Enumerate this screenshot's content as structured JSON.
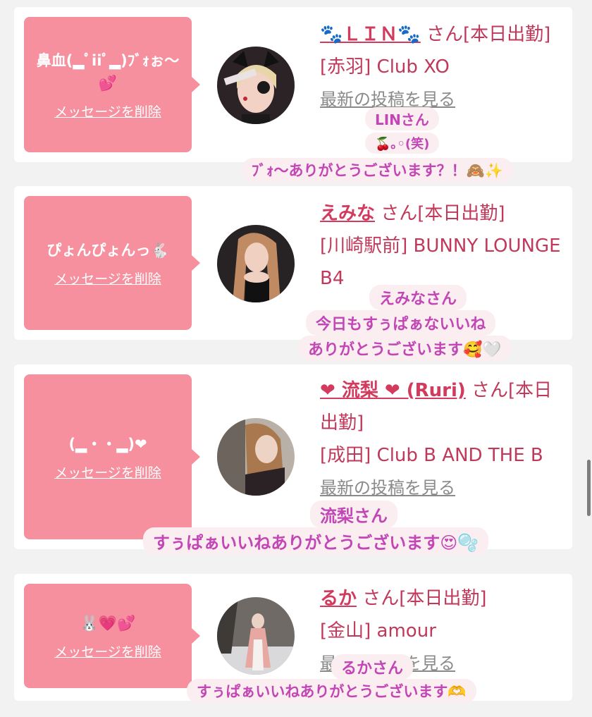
{
  "cards": [
    {
      "message": "鼻血(▂ﾟiiﾟ▂)ﾌﾞｫぉ〜💕",
      "delete_label": "メッセージを削除",
      "name": "🐾ＬＩＮ🐾",
      "suffix": "さん[本日出勤]",
      "shop": "[赤羽] Club XO",
      "latest": "最新の投稿を見る",
      "avatar_icon": "halloween-cat-ear-portrait"
    },
    {
      "message": "ぴょんぴょんっ🐇",
      "delete_label": "メッセージを削除",
      "name": "えみな",
      "suffix": "さん[本日出勤]",
      "shop": "[川崎駅前] BUNNY LOUNGE B4",
      "avatar_icon": "bunny-outfit-portrait"
    },
    {
      "message": "(▂・・▂)❤",
      "delete_label": "メッセージを削除",
      "name": "❤ 流梨 ❤ (Ruri)",
      "suffix": "さん[本日出勤]",
      "shop": "[成田] Club B AND THE B",
      "latest": "最新の投稿を見る",
      "avatar_icon": "window-light-portrait"
    },
    {
      "message": "🐰💗💕",
      "delete_label": "メッセージを削除",
      "name": "るか",
      "suffix": "さん[本日出勤]",
      "shop": "[金山] amour",
      "latest": "最新の投稿を見る",
      "avatar_icon": "snowy-outdoor-portrait"
    }
  ],
  "captions": [
    {
      "text": "LINさん"
    },
    {
      "text": "🍒｡◦(笑)"
    },
    {
      "text": "ﾌﾞｫ〜ありがとうございます？！🙈✨"
    },
    {
      "text": "えみなさん"
    },
    {
      "text": "今日もすぅぱぁないいね"
    },
    {
      "text": "ありがとうございます🥰🤍"
    },
    {
      "text": "流梨さん"
    },
    {
      "text": "すぅぱぁいいねありがとうございます😍🫧"
    },
    {
      "text": "るかさん"
    },
    {
      "text": "すぅぱぁいいねありがとうございます🫶"
    }
  ],
  "colors": {
    "bubble": "#f6909e",
    "name": "#d23a5e",
    "caption_text": "#c246b6",
    "caption_bg": "#fbeef0"
  }
}
